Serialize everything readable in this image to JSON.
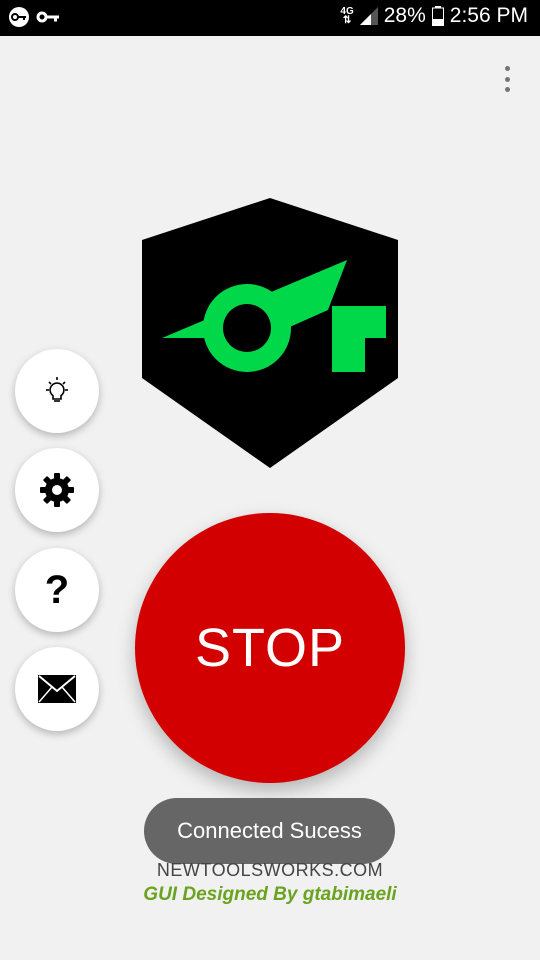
{
  "status_bar": {
    "network": "4G",
    "battery": "28%",
    "time": "2:56 PM",
    "icons": [
      "vpn-key-icon",
      "key-icon",
      "signal-icon",
      "battery-icon"
    ]
  },
  "menu": {
    "icon": "overflow-menu-icon"
  },
  "logo": {
    "name": "app-logo",
    "colors": {
      "shield": "#000000",
      "mark": "#00d84a"
    }
  },
  "side_buttons": [
    {
      "id": "tips",
      "icon": "lightbulb-icon"
    },
    {
      "id": "settings",
      "icon": "gear-icon"
    },
    {
      "id": "help",
      "icon": "question-icon",
      "label": "?"
    },
    {
      "id": "contact",
      "icon": "mail-icon"
    }
  ],
  "main_button": {
    "label": "STOP",
    "color": "#d30000"
  },
  "toast": {
    "text": "Connected Sucess"
  },
  "footer": {
    "site": "NEWTOOLSWORKS.COM",
    "credit": "GUI  Designed By gtabimaeli",
    "credit_color": "#6aa31f"
  }
}
